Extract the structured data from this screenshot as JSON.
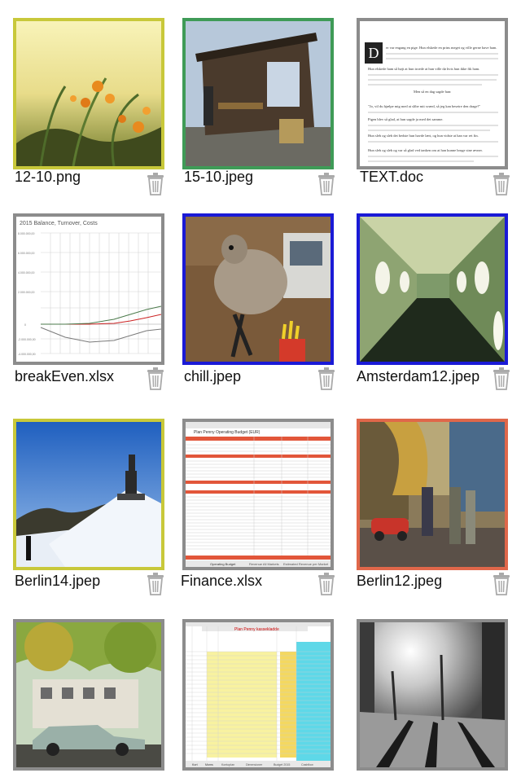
{
  "files": [
    {
      "name": "12-10.png",
      "border": "#c8c83a"
    },
    {
      "name": "15-10.jpeg",
      "border": "#3f9b57"
    },
    {
      "name": "TEXT.doc",
      "border": "#8c8c8c"
    },
    {
      "name": "breakEven.xlsx",
      "border": "#8c8c8c"
    },
    {
      "name": "chill.jpep",
      "border": "#1a1ad6"
    },
    {
      "name": "Amsterdam12.jpep",
      "border": "#1a1ad6"
    },
    {
      "name": "Berlin14.jpep",
      "border": "#c8c83a"
    },
    {
      "name": "Finance.xlsx",
      "border": "#8c8c8c"
    },
    {
      "name": "Berlin12.jpeg",
      "border": "#e0674a"
    },
    {
      "name": "",
      "border": "#8c8c8c"
    },
    {
      "name": "",
      "border": "#8c8c8c"
    },
    {
      "name": "",
      "border": "#8c8c8c"
    }
  ],
  "thumbs": {
    "doc_initial": "D",
    "doc_lines": [
      "er var engang en pige. Hun elskede en prins meget og ville gerne have ham.",
      "Hun elskede ham så højt at hun troede at hun ville dø hvis hun ikke fik ham.",
      "Men så en dag sagde han:",
      "\"Jo, vil du hjælpe mig med at slibe mit sværd, så jeg kan beseire den drage?\"",
      "Pigen blev så glad, at hun sagde ja med det samme.",
      "Hun sleb og sleb det bedste hun havde lært, og hun vidste at han var ret fin.",
      "Hun sleb og sleb og var så glad ved tanken om at han kunne bruge sine ævner."
    ],
    "chart_title": "2015 Balance, Turnover, Costs",
    "chart_yticks": [
      "8.000.000,00",
      "6.000.000,00",
      "4.000.000,00",
      "2.000.000,00",
      "0",
      "-2.000.000,00",
      "-4.000.000,00"
    ],
    "finance_title": "Plan Penny Operating Budget (EUR)",
    "finance_tabs": [
      "Operating Budget",
      "Revenue All Markets",
      "Estimated Revenue per Market"
    ],
    "ledger_title": "Plan Penny kassekladde",
    "ledger_tabs": [
      "Kort",
      "Moms",
      "Kontoplan",
      "Dimensioner",
      "Budget 2015",
      "Cashflow"
    ]
  }
}
